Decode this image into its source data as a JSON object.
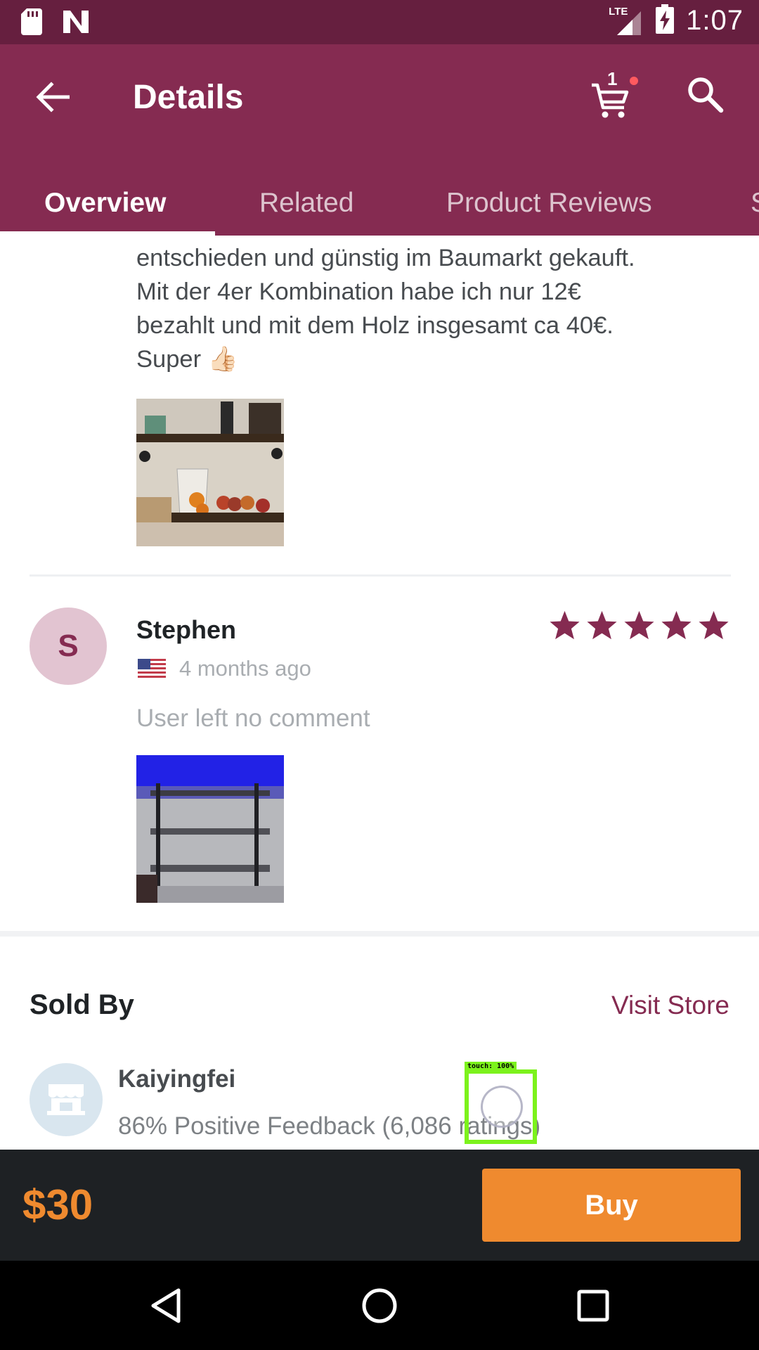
{
  "status_bar": {
    "time": "1:07",
    "network": "LTE",
    "icons": [
      "sd-card-icon",
      "n-notification-icon",
      "signal-icon",
      "battery-charging-icon"
    ]
  },
  "app_bar": {
    "title": "Details",
    "cart_count": "1",
    "back_icon": "arrow-left-icon",
    "cart_icon": "cart-icon",
    "search_icon": "search-icon"
  },
  "tabs": [
    {
      "label": "Overview",
      "active": true
    },
    {
      "label": "Related",
      "active": false
    },
    {
      "label": "Product Reviews",
      "active": false
    },
    {
      "label": "S",
      "active": false
    }
  ],
  "reviews": [
    {
      "text_lines": [
        "entschieden und günstig im Baumarkt gekauft.",
        "Mit der 4er Kombination habe ich nur 12€",
        "bezahlt und mit dem Holz insgesamt ca 40€.",
        "Super 👍🏻"
      ],
      "photo": "shelf-with-fruit-photo"
    },
    {
      "avatar_letter": "S",
      "name": "Stephen",
      "country_flag": "us-flag-icon",
      "date": "4 months ago",
      "rating": 5,
      "comment": "User left no comment",
      "photo": "pipe-shelf-photo"
    }
  ],
  "sold_by": {
    "title": "Sold By",
    "visit_store_label": "Visit Store",
    "store_name": "Kaiyingfei",
    "feedback": "86% Positive Feedback (6,086 ratings)"
  },
  "touch_overlay": {
    "label": "touch: 100%"
  },
  "buy_bar": {
    "price": "$30",
    "buy_label": "Buy"
  },
  "colors": {
    "status_bar": "#661f3f",
    "app_bar": "#852b51",
    "accent": "#852b51",
    "buy": "#ef8a2f",
    "buy_bar_bg": "#1e2124"
  }
}
